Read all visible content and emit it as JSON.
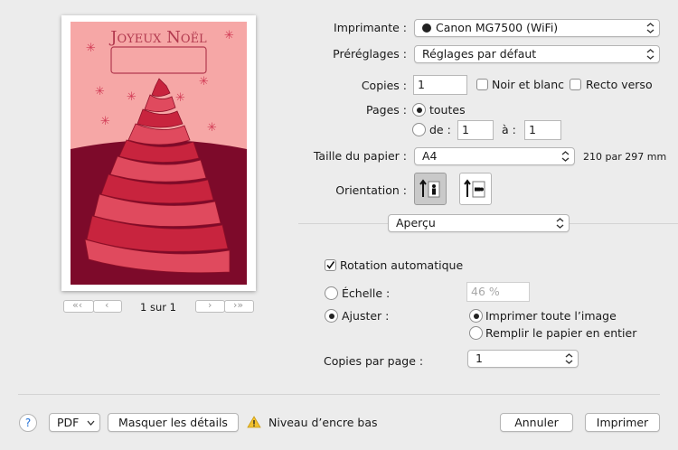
{
  "preview": {
    "card_title": "Joyeux Noël",
    "page_indicator": "1 sur 1",
    "colors": {
      "sky": "#f6a7a6",
      "ground": "#7d0a2a",
      "ribbon": "#c8243e",
      "title": "#b23a4f"
    }
  },
  "printer": {
    "label": "Imprimante :",
    "value": "Canon MG7500 (WiFi)"
  },
  "presets": {
    "label": "Préréglages :",
    "value": "Réglages par défaut"
  },
  "copies": {
    "label": "Copies :",
    "value": "1",
    "bw_label": "Noir et blanc",
    "duplex_label": "Recto verso"
  },
  "pages": {
    "label": "Pages :",
    "all_label": "toutes",
    "from_label": "de :",
    "from_value": "1",
    "to_label": "à :",
    "to_value": "1"
  },
  "paper": {
    "label": "Taille du papier :",
    "value": "A4",
    "dimensions": "210 par 297 mm"
  },
  "orientation": {
    "label": "Orientation :"
  },
  "section": {
    "value": "Aperçu"
  },
  "auto_rotate": {
    "label": "Rotation automatique"
  },
  "scale": {
    "label": "Échelle :",
    "placeholder": "46 %"
  },
  "fit": {
    "label": "Ajuster :",
    "print_entire_label": "Imprimer toute l’image",
    "fill_paper_label": "Remplir le papier en entier"
  },
  "copies_per_page": {
    "label": "Copies par page :",
    "value": "1"
  },
  "footer": {
    "help_label": "?",
    "pdf_label": "PDF",
    "hide_details_label": "Masquer les détails",
    "ink_warning": "Niveau d’encre bas",
    "cancel_label": "Annuler",
    "print_label": "Imprimer"
  }
}
